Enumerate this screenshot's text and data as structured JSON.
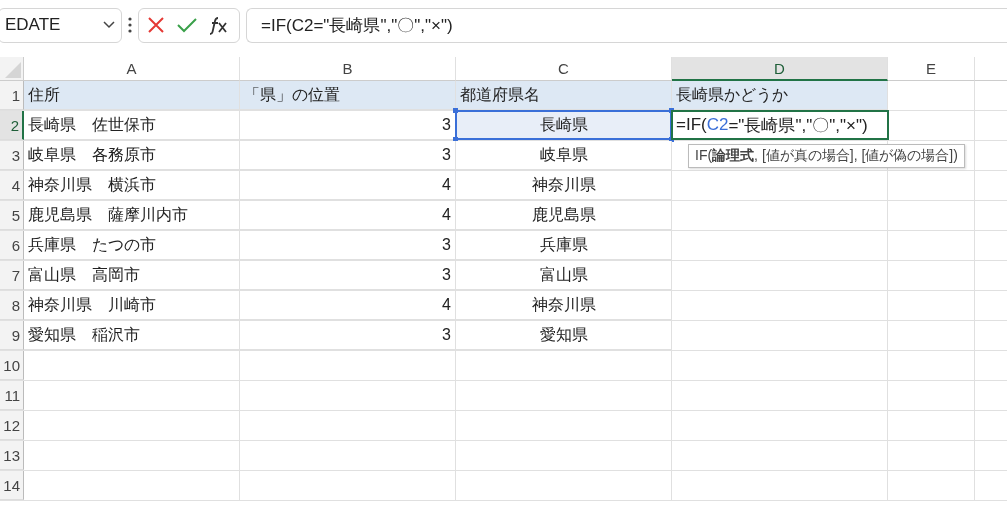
{
  "name_box": {
    "value": "EDATE"
  },
  "formula_bar": {
    "value": "=IF(C2=\"長崎県\",\"〇\",\"×\")"
  },
  "columns": [
    {
      "label": "A",
      "selected": false
    },
    {
      "label": "B",
      "selected": false
    },
    {
      "label": "C",
      "selected": false
    },
    {
      "label": "D",
      "selected": true
    },
    {
      "label": "E",
      "selected": false
    }
  ],
  "rows": [
    {
      "number": "1",
      "selected": false,
      "cells": [
        {
          "kind": "header",
          "text": "住所"
        },
        {
          "kind": "header",
          "text": "「県」の位置"
        },
        {
          "kind": "header",
          "text": "都道府県名"
        },
        {
          "kind": "header",
          "text": "長崎県かどうか"
        }
      ]
    },
    {
      "number": "2",
      "selected": true,
      "cells": [
        {
          "kind": "text",
          "text": "長崎県　佐世保市"
        },
        {
          "kind": "number",
          "text": "3"
        },
        {
          "kind": "reference",
          "text": "長崎県"
        },
        {
          "kind": "editing",
          "parts": [
            {
              "kind": "plain",
              "text": "=IF("
            },
            {
              "kind": "ref",
              "text": "C2"
            },
            {
              "kind": "plain",
              "text": "=\"長崎県\",\"〇\",\"×\")"
            }
          ],
          "tooltip": "IF(**論理式**, [値が真の場合], [値が偽の場合])"
        }
      ]
    },
    {
      "number": "3",
      "selected": false,
      "cells": [
        {
          "kind": "text",
          "text": "岐阜県　各務原市"
        },
        {
          "kind": "number",
          "text": "3"
        },
        {
          "kind": "center",
          "text": "岐阜県"
        }
      ]
    },
    {
      "number": "4",
      "selected": false,
      "cells": [
        {
          "kind": "text",
          "text": "神奈川県　横浜市"
        },
        {
          "kind": "number",
          "text": "4"
        },
        {
          "kind": "center",
          "text": "神奈川県"
        }
      ]
    },
    {
      "number": "5",
      "selected": false,
      "cells": [
        {
          "kind": "text",
          "text": "鹿児島県　薩摩川内市"
        },
        {
          "kind": "number",
          "text": "4"
        },
        {
          "kind": "center",
          "text": "鹿児島県"
        }
      ]
    },
    {
      "number": "6",
      "selected": false,
      "cells": [
        {
          "kind": "text",
          "text": "兵庫県　たつの市"
        },
        {
          "kind": "number",
          "text": "3"
        },
        {
          "kind": "center",
          "text": "兵庫県"
        }
      ]
    },
    {
      "number": "7",
      "selected": false,
      "cells": [
        {
          "kind": "text",
          "text": "富山県　高岡市"
        },
        {
          "kind": "number",
          "text": "3"
        },
        {
          "kind": "center",
          "text": "富山県"
        }
      ]
    },
    {
      "number": "8",
      "selected": false,
      "cells": [
        {
          "kind": "text",
          "text": "神奈川県　川崎市"
        },
        {
          "kind": "number",
          "text": "4"
        },
        {
          "kind": "center",
          "text": "神奈川県"
        }
      ]
    },
    {
      "number": "9",
      "selected": false,
      "cells": [
        {
          "kind": "text",
          "text": "愛知県　稲沢市"
        },
        {
          "kind": "number",
          "text": "3"
        },
        {
          "kind": "center",
          "text": "愛知県"
        }
      ]
    },
    {
      "number": "10",
      "selected": false,
      "cells": []
    },
    {
      "number": "11",
      "selected": false,
      "cells": []
    },
    {
      "number": "12",
      "selected": false,
      "cells": []
    },
    {
      "number": "13",
      "selected": false,
      "cells": []
    },
    {
      "number": "14",
      "selected": false,
      "cells": []
    }
  ]
}
